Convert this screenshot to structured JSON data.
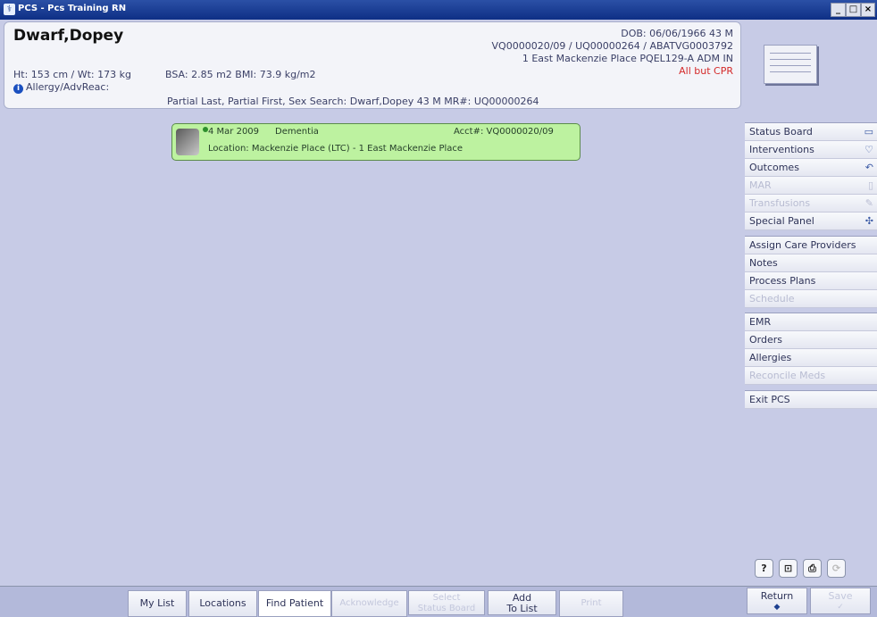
{
  "window": {
    "title": "PCS - Pcs Training RN",
    "minimize": "_",
    "maximize": "□",
    "close": "×"
  },
  "patient": {
    "name": "Dwarf,Dopey",
    "dob_line": "DOB: 06/06/1966 43 M",
    "ids_line": "VQ0000020/09 / UQ00000264 / ABATVG0003792",
    "location_line": "1 East Mackenzie Place  PQEL129-A  ADM IN",
    "code_status": "All but CPR",
    "ht_wt": "Ht: 153 cm / Wt: 173 kg",
    "bsa_bmi": "BSA: 2.85 m2   BMI: 73.9 kg/m2",
    "allergy_label": "Allergy/AdvReac:",
    "search_line": "Partial Last, Partial First, Sex Search: Dwarf,Dopey 43 M  MR#: UQ00000264"
  },
  "encounter": {
    "date": "4 Mar 2009",
    "diagnosis": "Dementia",
    "acct": "Acct#:  VQ0000020/09",
    "location": "Location:  Mackenzie Place (LTC) - 1 East Mackenzie Place"
  },
  "sidebar": {
    "group1": [
      {
        "label": "Status Board",
        "icon": "▭",
        "enabled": true
      },
      {
        "label": "Interventions",
        "icon": "♡",
        "enabled": true
      },
      {
        "label": "Outcomes",
        "icon": "↶",
        "enabled": true
      },
      {
        "label": "MAR",
        "icon": "▯",
        "enabled": false
      },
      {
        "label": "Transfusions",
        "icon": "✎",
        "enabled": false
      },
      {
        "label": "Special Panel",
        "icon": "✣",
        "enabled": true
      }
    ],
    "group2": [
      {
        "label": "Assign Care Providers"
      },
      {
        "label": "Notes"
      },
      {
        "label": "Process Plans"
      },
      {
        "label": "Schedule"
      }
    ],
    "group3": [
      {
        "label": "EMR"
      },
      {
        "label": "Orders"
      },
      {
        "label": "Allergies"
      },
      {
        "label": "Reconcile Meds"
      }
    ],
    "group4": [
      {
        "label": "Exit PCS"
      }
    ],
    "small_buttons": [
      "?",
      "⊡",
      "⎙",
      "⟳"
    ]
  },
  "bottom": {
    "my_list": "My List",
    "locations": "Locations",
    "find_patient": "Find Patient",
    "acknowledge": "Acknowledge",
    "select_line1": "Select",
    "select_line2": "Status Board",
    "add_line1": "Add",
    "add_line2": "To List",
    "print": "Print",
    "return_label": "Return",
    "return_icon": "◆",
    "save_label": "Save",
    "save_icon": "✓"
  }
}
